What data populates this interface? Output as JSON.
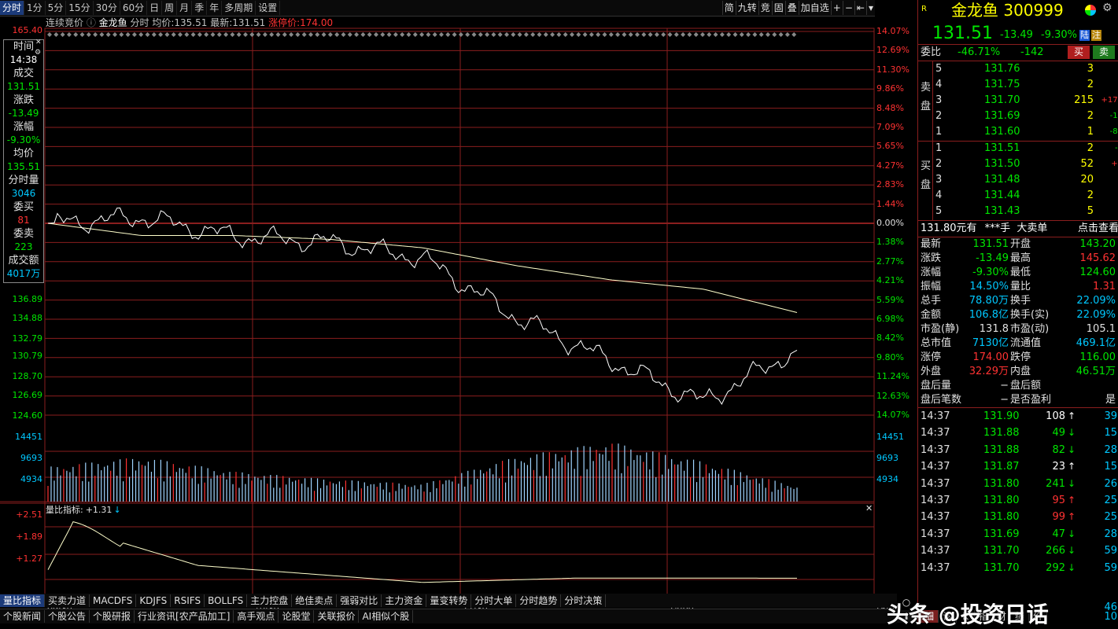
{
  "toolbar": {
    "periods": [
      "分时",
      "1分",
      "5分",
      "15分",
      "30分",
      "60分",
      "日",
      "周",
      "月",
      "季",
      "年",
      "多周期",
      "设置"
    ],
    "active": "分时",
    "right_items": [
      "简",
      "九转",
      "竞",
      "固",
      "叠",
      "加自选",
      "+",
      "−",
      "⇤",
      "▾"
    ]
  },
  "info_line": {
    "auction": "连续竞价",
    "name": "金龙鱼",
    "mode": "分时",
    "avg_label": "均价:",
    "avg": "135.51",
    "last_label": "最新:",
    "last": "131.51",
    "limit_label": "涨停价:",
    "limit": "174.00"
  },
  "price_axis_left": [
    "165.40",
    "136.89",
    "134.88",
    "132.79",
    "130.79",
    "128.70",
    "126.69",
    "124.60"
  ],
  "pct_axis_right_red": [
    "14.07%",
    "12.69%",
    "11.30%",
    "9.86%",
    "8.48%",
    "7.09%",
    "5.65%",
    "4.27%",
    "2.83%",
    "1.44%"
  ],
  "pct_axis_zero": "0.00%",
  "pct_axis_right_green": [
    "1.38%",
    "2.77%",
    "4.21%",
    "5.59%",
    "6.98%",
    "8.42%",
    "9.80%",
    "11.24%",
    "12.63%",
    "14.07%"
  ],
  "volume_axis": [
    "14451",
    "9693",
    "4934"
  ],
  "indicator": {
    "label": "量比指标:",
    "value": "+1.31",
    "arrow": "↓",
    "axis": [
      "+2.51",
      "+1.89",
      "+1.27"
    ]
  },
  "time_axis": [
    "09:30",
    "10:30",
    "11:30",
    "14:00",
    "15:00"
  ],
  "infobox": {
    "rows": [
      {
        "k": "时间",
        "v": "14:38",
        "c": "#ffffff"
      },
      {
        "k": "成交",
        "v": "131.51",
        "c": "#00e600"
      },
      {
        "k": "涨跌",
        "v": "-13.49",
        "c": "#00e600"
      },
      {
        "k": "涨幅",
        "v": "-9.30%",
        "c": "#00e600"
      },
      {
        "k": "均价",
        "v": "135.51",
        "c": "#00e600"
      },
      {
        "k": "分时量",
        "v": "3046",
        "c": "#00c8ff"
      },
      {
        "k": "委买",
        "v": "81",
        "c": "#ff3232"
      },
      {
        "k": "委卖",
        "v": "223",
        "c": "#00e600"
      },
      {
        "k": "成交额",
        "v": "4017万",
        "c": "#00c8ff"
      }
    ]
  },
  "bottom_tabs": [
    "量比指标",
    "买卖力道",
    "MACDFS",
    "KDJFS",
    "RSIFS",
    "BOLLFS",
    "主力控盘",
    "绝佳卖点",
    "强弱对比",
    "主力资金",
    "量变转势",
    "分时大单",
    "分时趋势",
    "分时决策"
  ],
  "bottom_tabs_active": "量比指标",
  "bottom_tabs2": [
    "个股新闻",
    "个股公告",
    "个股研报",
    "行业资讯[农产品加工]",
    "高手观点",
    "论股堂",
    "关联报价",
    "AI相似个股"
  ],
  "right_panel": {
    "r_mark": "R",
    "stock_name": "金龙鱼",
    "stock_code": "300999",
    "price": "131.51",
    "change": "-13.49",
    "change_pct": "-9.30%",
    "tag_lu": "陆",
    "tag_zhu": "注",
    "weibi_label": "委比",
    "weibi": "-46.71%",
    "weicha": "-142",
    "buy_btn": "买",
    "sell_btn": "卖",
    "sell_side_label": [
      "卖",
      "盘"
    ],
    "buy_side_label": [
      "买",
      "盘"
    ],
    "asks": [
      {
        "n": "5",
        "p": "131.76",
        "v": "3",
        "c": ""
      },
      {
        "n": "4",
        "p": "131.75",
        "v": "2",
        "c": ""
      },
      {
        "n": "3",
        "p": "131.70",
        "v": "215",
        "c": "+173"
      },
      {
        "n": "2",
        "p": "131.69",
        "v": "2",
        "c": "-11"
      },
      {
        "n": "1",
        "p": "131.60",
        "v": "1",
        "c": "-80"
      }
    ],
    "bids": [
      {
        "n": "1",
        "p": "131.51",
        "v": "2",
        "c": "-1"
      },
      {
        "n": "2",
        "p": "131.50",
        "v": "52",
        "c": "+1"
      },
      {
        "n": "3",
        "p": "131.48",
        "v": "20",
        "c": ""
      },
      {
        "n": "4",
        "p": "131.44",
        "v": "2",
        "c": ""
      },
      {
        "n": "5",
        "p": "131.43",
        "v": "5",
        "c": ""
      }
    ],
    "big_order_line": {
      "price": "131.80",
      "unit": "元有",
      "hands": "***手",
      "label": "大卖单",
      "action": "点击查看"
    },
    "quotes": [
      {
        "k1": "最新",
        "v1": "131.51",
        "c1": "#00e600",
        "k2": "开盘",
        "v2": "143.20",
        "c2": "#00e600"
      },
      {
        "k1": "涨跌",
        "v1": "-13.49",
        "c1": "#00e600",
        "k2": "最高",
        "v2": "145.62",
        "c2": "#ff3232"
      },
      {
        "k1": "涨幅",
        "v1": "-9.30%",
        "c1": "#00e600",
        "k2": "最低",
        "v2": "124.60",
        "c2": "#00e600"
      },
      {
        "k1": "振幅",
        "v1": "14.50%",
        "c1": "#00c8ff",
        "k2": "量比",
        "v2": "1.31",
        "c2": "#ff3232"
      },
      {
        "k1": "总手",
        "v1": "78.80万",
        "c1": "#00c8ff",
        "k2": "换手",
        "v2": "22.09%",
        "c2": "#00c8ff"
      },
      {
        "k1": "金额",
        "v1": "106.8亿",
        "c1": "#00c8ff",
        "k2": "换手(实)",
        "v2": "22.09%",
        "c2": "#00c8ff"
      },
      {
        "k1": "市盈(静)",
        "v1": "131.8",
        "c1": "#e0e0e0",
        "k2": "市盈(动)",
        "v2": "105.1",
        "c2": "#e0e0e0"
      },
      {
        "k1": "总市值",
        "v1": "7130亿",
        "c1": "#00c8ff",
        "k2": "流通值",
        "v2": "469.1亿",
        "c2": "#00c8ff"
      },
      {
        "k1": "涨停",
        "v1": "174.00",
        "c1": "#ff3232",
        "k2": "跌停",
        "v2": "116.00",
        "c2": "#00e600"
      },
      {
        "k1": "外盘",
        "v1": "32.29万",
        "c1": "#ff3232",
        "k2": "内盘",
        "v2": "46.51万",
        "c2": "#00e600"
      },
      {
        "k1": "盘后量",
        "v1": "−",
        "c1": "#e0e0e0",
        "k2": "盘后额",
        "v2": "",
        "c2": "#e0e0e0"
      },
      {
        "k1": "盘后笔数",
        "v1": "−",
        "c1": "#e0e0e0",
        "k2": "是否盈利",
        "v2": "是",
        "c2": "#e0e0e0"
      }
    ],
    "trades": [
      {
        "t": "14:37",
        "p": "131.90",
        "v": "108",
        "a": "↑",
        "c": "#ffffff",
        "n": "39"
      },
      {
        "t": "14:37",
        "p": "131.88",
        "v": "49",
        "a": "↓",
        "c": "#00e600",
        "n": "15"
      },
      {
        "t": "14:37",
        "p": "131.88",
        "v": "82",
        "a": "↓",
        "c": "#00e600",
        "n": "28"
      },
      {
        "t": "14:37",
        "p": "131.87",
        "v": "23",
        "a": "↑",
        "c": "#ffffff",
        "n": "15"
      },
      {
        "t": "14:37",
        "p": "131.80",
        "v": "241",
        "a": "↓",
        "c": "#00e600",
        "n": "26"
      },
      {
        "t": "14:37",
        "p": "131.80",
        "v": "95",
        "a": "↑",
        "c": "#ff3232",
        "n": "25"
      },
      {
        "t": "14:37",
        "p": "131.80",
        "v": "99",
        "a": "↑",
        "c": "#ff3232",
        "n": "25"
      },
      {
        "t": "14:37",
        "p": "131.69",
        "v": "47",
        "a": "↓",
        "c": "#00e600",
        "n": "28"
      },
      {
        "t": "14:37",
        "p": "131.70",
        "v": "266",
        "a": "↓",
        "c": "#00e600",
        "n": "59"
      },
      {
        "t": "14:37",
        "p": "131.70",
        "v": "292",
        "a": "↓",
        "c": "#00e600",
        "n": "59"
      }
    ],
    "trade_partial": [
      "46",
      "10"
    ],
    "bottom_tabs": [
      "细",
      "诊",
      "K",
      "指",
      "财",
      "绩",
      "价"
    ],
    "bottom_active": "细"
  },
  "watermark": "头条 @投资日话",
  "colors": {
    "up": "#ff3232",
    "down": "#00e600",
    "grid": "#8a1e1e",
    "price_line": "#ffffff",
    "avg_line": "#ffffcc",
    "volume": "#9fd4ff"
  },
  "chart_data": {
    "type": "line",
    "title": "金龙鱼 分时",
    "prev_close": 145.0,
    "ylim": [
      124.6,
      165.4
    ],
    "x": [
      "09:30",
      "10:00",
      "10:30",
      "11:00",
      "11:30",
      "13:30",
      "14:00",
      "14:30",
      "14:38"
    ],
    "series": [
      {
        "name": "最新",
        "values": [
          145.0,
          145.62,
          143.6,
          143.0,
          141.3,
          135.0,
          130.4,
          126.0,
          131.51
        ]
      },
      {
        "name": "均价",
        "values": [
          145.0,
          143.7,
          143.7,
          143.3,
          142.4,
          140.5,
          139.0,
          138.0,
          135.51
        ]
      }
    ],
    "volume": [
      7000,
      9000,
      6000,
      4500,
      3500,
      9000,
      12000,
      8000,
      3046
    ]
  }
}
